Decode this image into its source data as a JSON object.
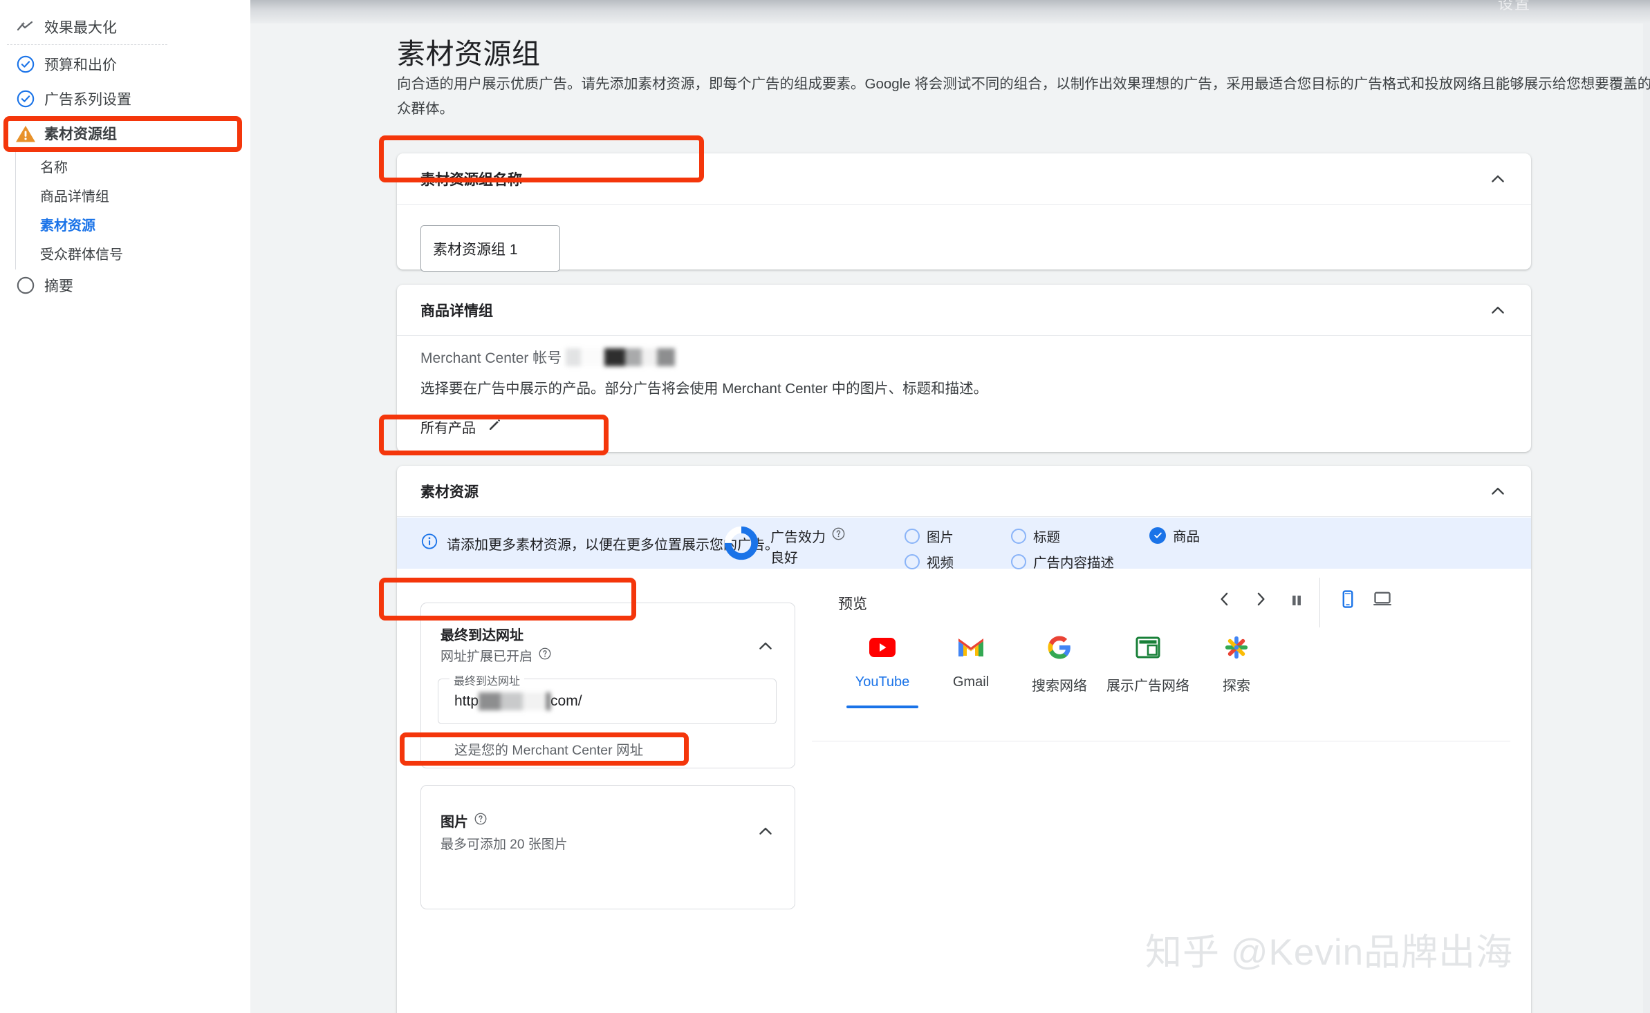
{
  "window": {
    "top_strip_label": "设置"
  },
  "sidebar": {
    "items": [
      {
        "label": "效果最大化",
        "icon": "trending-spark-icon",
        "state": "plain"
      },
      {
        "label": "预算和出价",
        "icon": "check-circle-icon",
        "state": "done"
      },
      {
        "label": "广告系列设置",
        "icon": "check-circle-icon",
        "state": "done"
      },
      {
        "label": "素材资源组",
        "icon": "warning-triangle-icon",
        "state": "warning"
      },
      {
        "label": "摘要",
        "icon": "empty-circle-icon",
        "state": "pending"
      }
    ],
    "sub_items": [
      {
        "label": "名称",
        "active": false
      },
      {
        "label": "商品详情组",
        "active": false
      },
      {
        "label": "素材资源",
        "active": true
      },
      {
        "label": "受众群体信号",
        "active": false
      }
    ]
  },
  "page": {
    "title": "素材资源组",
    "description": "向合适的用户展示优质广告。请先添加素材资源，即每个广告的组成要素。Google 将会测试不同的组合，以制作出效果理想的广告，采用最适合您目标的广告格式和投放网络且能够展示给您想要覆盖的受众群体。"
  },
  "card_name": {
    "title": "素材资源组名称",
    "input_value": "素材资源组 1",
    "collapse_icon": "chevron-up-icon"
  },
  "card_product": {
    "title": "商品详情组",
    "merchant_label": "Merchant Center 帐号",
    "merchant_value_redacted": true,
    "helper": "选择要在广告中展示的产品。部分广告将会使用 Merchant Center 中的图片、标题和描述。",
    "selection_label": "所有产品",
    "edit_icon": "pencil-icon",
    "collapse_icon": "chevron-up-icon"
  },
  "card_assets": {
    "title": "素材资源",
    "collapse_icon": "chevron-up-icon",
    "banner": {
      "info_icon": "info-circle-icon",
      "message": "请添加更多素材资源，以便在更多位置展示您的广告。",
      "strength_label": "广告效力",
      "strength_help_icon": "help-circle-icon",
      "strength_value": "良好",
      "donut_percent": 75,
      "checklist": [
        {
          "label": "图片",
          "checked": false
        },
        {
          "label": "标题",
          "checked": false
        },
        {
          "label": "商品",
          "checked": true
        },
        {
          "label": "视频",
          "checked": false
        },
        {
          "label": "广告内容描述",
          "checked": false
        }
      ]
    },
    "final_url_panel": {
      "title": "最终到达网址",
      "subtitle": "网址扩展已开启",
      "subtitle_help_icon": "help-circle-icon",
      "collapse_icon": "chevron-up-icon",
      "field_legend": "最终到达网址",
      "field_prefix": "http",
      "field_suffix": "com/",
      "field_redacted": true,
      "helper": "这是您的 Merchant Center 网址"
    },
    "images_panel": {
      "title": "图片",
      "title_help_icon": "help-circle-icon",
      "subtitle": "最多可添加 20 张图片",
      "collapse_icon": "chevron-up-icon"
    },
    "preview": {
      "title": "预览",
      "prev_icon": "chevron-left-icon",
      "next_icon": "chevron-right-icon",
      "pause_icon": "pause-icon",
      "mobile_icon": "mobile-device-icon",
      "desktop_icon": "desktop-device-icon",
      "active_device": "mobile",
      "tabs": [
        {
          "label": "YouTube",
          "icon": "youtube-icon",
          "active": true
        },
        {
          "label": "Gmail",
          "icon": "gmail-icon",
          "active": false
        },
        {
          "label": "搜索网络",
          "icon": "google-g-icon",
          "active": false
        },
        {
          "label": "展示广告网络",
          "icon": "display-network-icon",
          "active": false
        },
        {
          "label": "探索",
          "icon": "discover-icon",
          "active": false
        }
      ]
    }
  },
  "annotations": {
    "color": "#f4360b",
    "boxes": [
      "sidebar-item-asset-group",
      "card-name-header-and-input",
      "all-products-selector",
      "assets-card-header",
      "final-url-panel-title"
    ]
  },
  "watermark": {
    "text": "知乎 @Kevin品牌出海"
  }
}
